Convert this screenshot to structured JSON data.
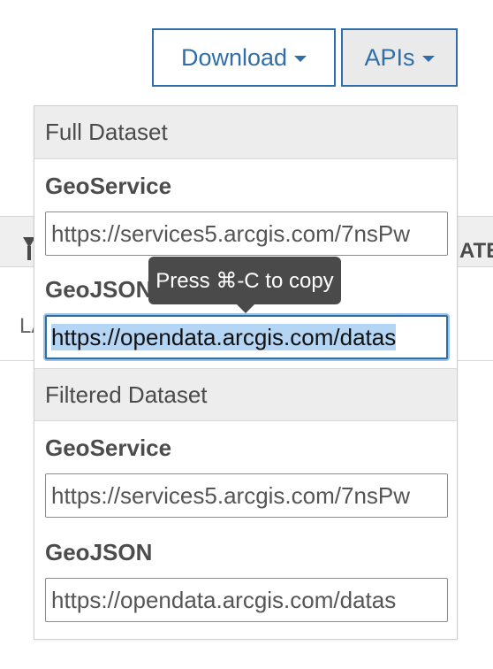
{
  "toolbar": {
    "download_label": "Download",
    "apis_label": "APIs"
  },
  "background_table": {
    "header_fragment": "ATE",
    "row_fragment": "LA"
  },
  "api_panel": {
    "full_dataset": {
      "header": "Full Dataset",
      "geoservice_label": "GeoService",
      "geoservice_url": "https://services5.arcgis.com/7nsPw",
      "geojson_label": "GeoJSON",
      "geojson_url": "https://opendata.arcgis.com/datas"
    },
    "filtered_dataset": {
      "header": "Filtered Dataset",
      "geoservice_label": "GeoService",
      "geoservice_url": "https://services5.arcgis.com/7nsPw",
      "geojson_label": "GeoJSON",
      "geojson_url": "https://opendata.arcgis.com/datas"
    }
  },
  "tooltip": {
    "text": "Press ⌘-C to copy"
  },
  "colors": {
    "accent": "#2f6ea8",
    "selection": "#b5d5f5",
    "tooltip_bg": "#4a4a4a"
  }
}
